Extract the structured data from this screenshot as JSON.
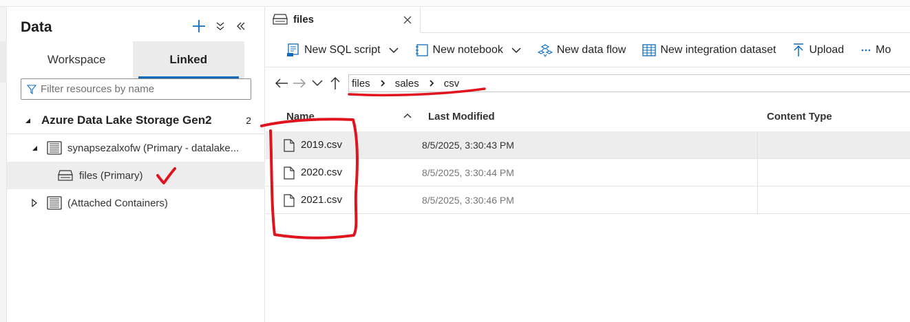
{
  "data_panel": {
    "title": "Data",
    "tabs": [
      {
        "label": "Workspace",
        "active": false
      },
      {
        "label": "Linked",
        "active": true
      }
    ],
    "filter_placeholder": "Filter resources by name",
    "tree": {
      "root": {
        "label": "Azure Data Lake Storage Gen2",
        "count": "2",
        "expanded": true
      },
      "account": {
        "label": "synapsezalxofw (Primary - datalake...",
        "expanded": true
      },
      "container": {
        "label": "files (Primary)",
        "selected": true
      },
      "attached": {
        "label": "(Attached Containers)",
        "expanded": false
      }
    }
  },
  "doc_tab": {
    "label": "files"
  },
  "toolbar": {
    "new_sql_script": "New SQL script",
    "new_notebook": "New notebook",
    "new_data_flow": "New data flow",
    "new_integration_dataset": "New integration dataset",
    "upload": "Upload",
    "more": "Mo"
  },
  "breadcrumb": [
    "files",
    "sales",
    "csv"
  ],
  "table": {
    "columns": {
      "name": "Name",
      "last_modified": "Last Modified",
      "content_type": "Content Type"
    },
    "sort": "ascending",
    "rows": [
      {
        "name": "2019.csv",
        "last_modified": "8/5/2025, 3:30:43 PM",
        "selected": true
      },
      {
        "name": "2020.csv",
        "last_modified": "8/5/2025, 3:30:44 PM",
        "selected": false
      },
      {
        "name": "2021.csv",
        "last_modified": "8/5/2025, 3:30:46 PM",
        "selected": false
      }
    ]
  },
  "colors": {
    "accent": "#0f6cbd",
    "annotation": "#e0141e",
    "selection": "#ededed"
  }
}
